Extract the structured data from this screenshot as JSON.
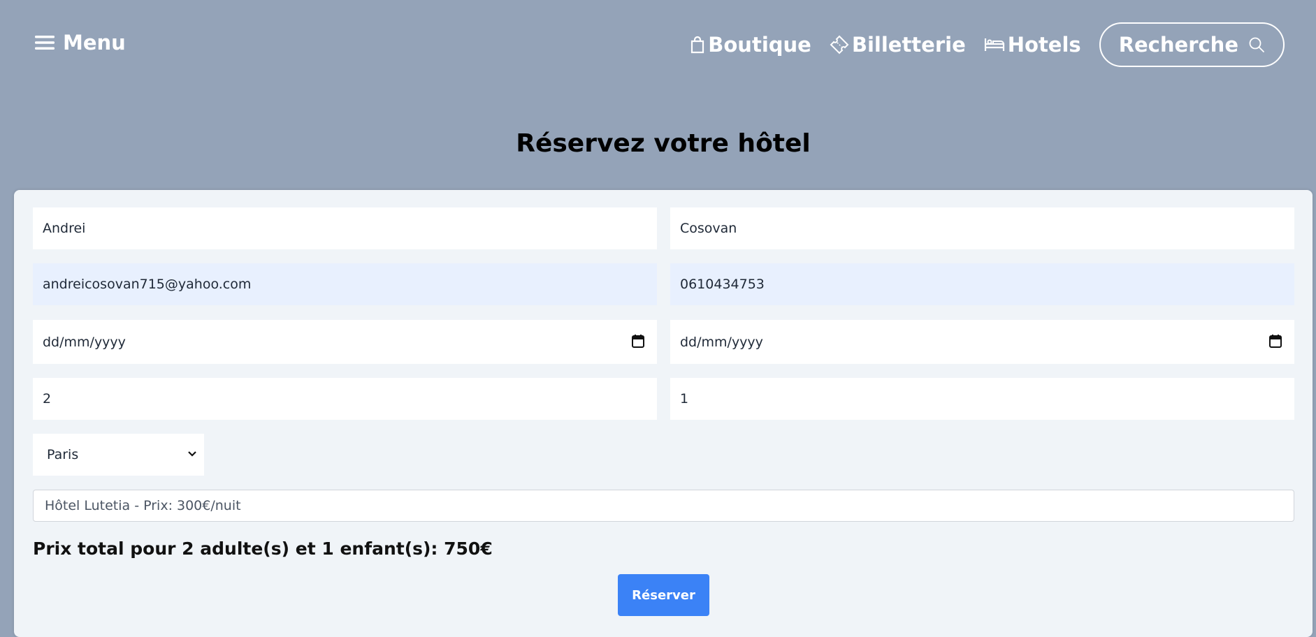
{
  "header": {
    "menu_label": "Menu",
    "nav": [
      {
        "label": "Boutique",
        "icon": "shopping-bag-icon"
      },
      {
        "label": "Billetterie",
        "icon": "ticket-icon"
      },
      {
        "label": "Hotels",
        "icon": "bed-icon"
      }
    ],
    "search_label": "Recherche"
  },
  "page_title": "Réservez votre hôtel",
  "form": {
    "first_name": "Andrei",
    "last_name": "Cosovan",
    "email": "andreicosovan715@yahoo.com",
    "phone": "0610434753",
    "check_in": "dd/mm/yyyy",
    "check_out": "dd/mm/yyyy",
    "adults": "2",
    "children": "1",
    "city": "Paris",
    "hotel": "Hôtel Lutetia - Prix: 300€/nuit",
    "total": "Prix total pour 2 adulte(s) et 1 enfant(s): 750€",
    "submit_label": "Réserver"
  },
  "colors": {
    "background": "#94a3b8",
    "card": "#f0f4f8",
    "accent": "#3b82f6",
    "autofill": "#e8f0fe"
  }
}
